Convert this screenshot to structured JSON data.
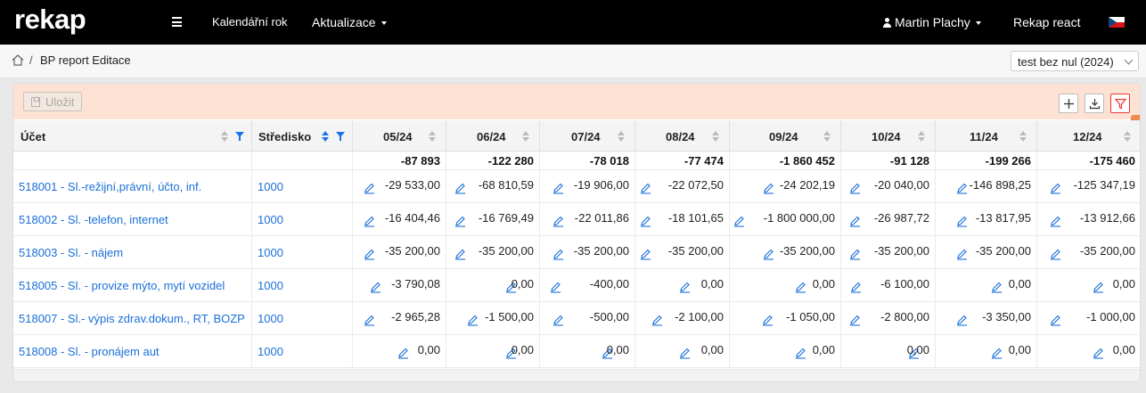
{
  "navbar": {
    "brand": "rekap",
    "items": [
      "Kalendářní rok",
      "Aktualizace",
      "Martin Plachy",
      "Rekap react"
    ]
  },
  "breadcrumb": {
    "separator": "/",
    "page": "BP report Editace"
  },
  "selector": {
    "value": "test bez nul (2024)"
  },
  "toolbar": {
    "save_label": "Uložit"
  },
  "table": {
    "headers": {
      "account": "Účet",
      "center": "Středisko",
      "months": [
        "05/24",
        "06/24",
        "07/24",
        "08/24",
        "09/24",
        "10/24",
        "11/24",
        "12/24"
      ]
    },
    "totals": [
      "-87 893",
      "-122 280",
      "-78 018",
      "-77 474",
      "-1 860 452",
      "-91 128",
      "-199 266",
      "-175 460"
    ],
    "rows": [
      {
        "account": "518001 - Sl.-režijní,právní, účto, inf.",
        "center": "1000",
        "values": [
          "-29 533,00",
          "-68 810,59",
          "-19 906,00",
          "-22 072,50",
          "-24 202,19",
          "-20 040,00",
          "-146 898,25",
          "-125 347,19"
        ]
      },
      {
        "account": "518002 - Sl. -telefon, internet",
        "center": "1000",
        "values": [
          "-16 404,46",
          "-16 769,49",
          "-22 011,86",
          "-18 101,65",
          "-1 800 000,00",
          "-26 987,72",
          "-13 817,95",
          "-13 912,66"
        ]
      },
      {
        "account": "518003 - Sl. - nájem",
        "center": "1000",
        "values": [
          "-35 200,00",
          "-35 200,00",
          "-35 200,00",
          "-35 200,00",
          "-35 200,00",
          "-35 200,00",
          "-35 200,00",
          "-35 200,00"
        ]
      },
      {
        "account": "518005 - Sl. - provize mýto, mytí vozidel",
        "center": "1000",
        "values": [
          "-3 790,08",
          "0,00",
          "-400,00",
          "0,00",
          "0,00",
          "-6 100,00",
          "0,00",
          "0,00"
        ]
      },
      {
        "account": "518007 - Sl.- výpis zdrav.dokum., RT, BOZP",
        "center": "1000",
        "values": [
          "-2 965,28",
          "-1 500,00",
          "-500,00",
          "-2 100,00",
          "-1 050,00",
          "-2 800,00",
          "-3 350,00",
          "-1 000,00"
        ]
      },
      {
        "account": "518008 - Sl. - pronájem aut",
        "center": "1000",
        "values": [
          "0,00",
          "0,00",
          "0,00",
          "0,00",
          "0,00",
          "0,00",
          "0,00",
          "0,00"
        ]
      }
    ]
  },
  "colors": {
    "navbar": "#000000",
    "toolbar": "#fde2d4",
    "link": "#1a6fd8",
    "accent": "#1a73e8",
    "gear_tab": "#f08a4b"
  },
  "icons": [
    "hamburger-icon",
    "user-icon",
    "czech-flag-icon",
    "home-icon",
    "save-icon",
    "add-icon",
    "download-icon",
    "filter-clear-icon",
    "gear-icon",
    "sort-icon",
    "filter-icon",
    "pencil-icon"
  ]
}
